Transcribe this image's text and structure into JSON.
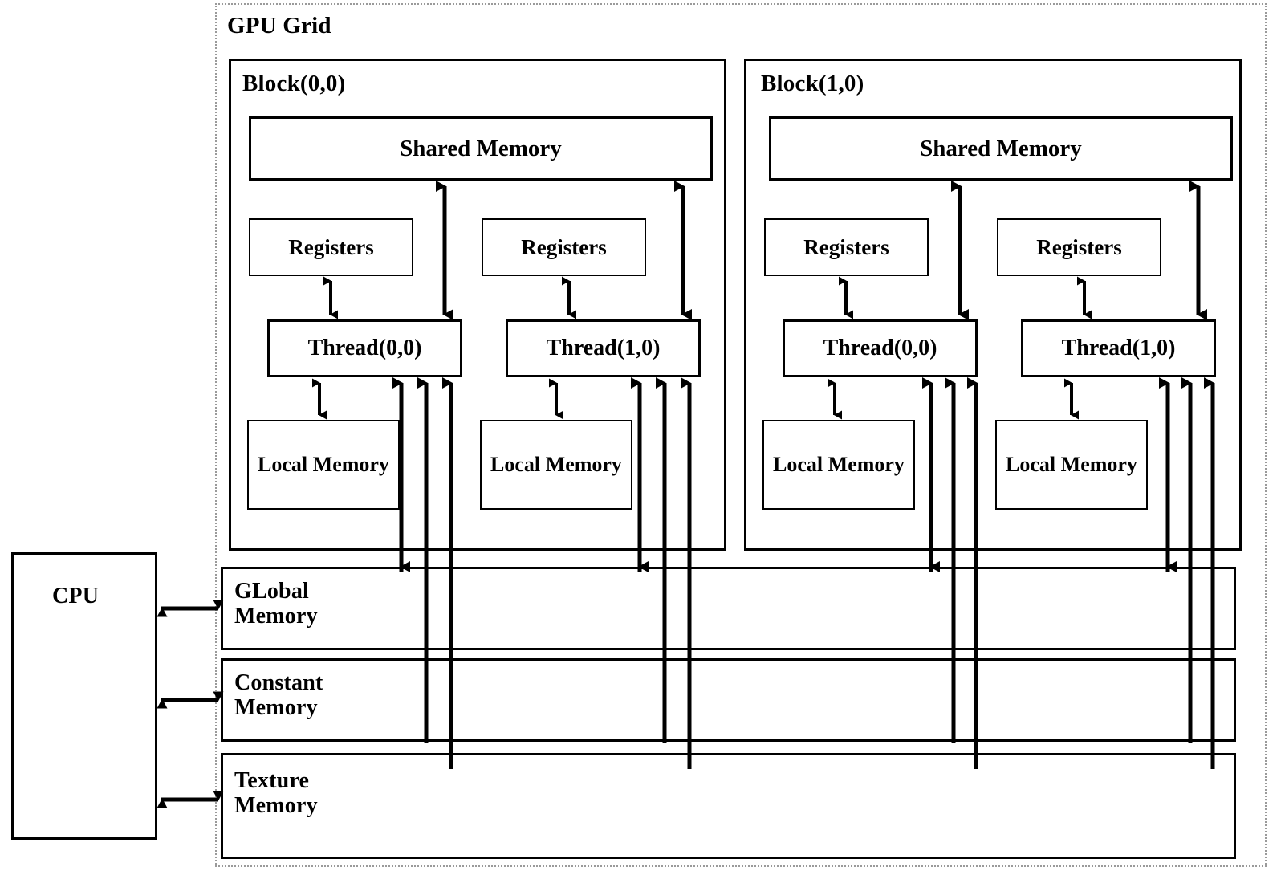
{
  "diagram": {
    "title": "GPU Grid",
    "type": "cuda-memory-hierarchy"
  },
  "host": {
    "cpu_label": "CPU"
  },
  "blocks": [
    {
      "label": "Block(0,0)",
      "shared_memory_label": "Shared  Memory",
      "threads": [
        {
          "registers_label": "Registers",
          "thread_label": "Thread(0,0)",
          "local_memory_label": "Local\nMemory"
        },
        {
          "registers_label": "Registers",
          "thread_label": "Thread(1,0)",
          "local_memory_label": "Local\nMemory"
        }
      ]
    },
    {
      "label": "Block(1,0)",
      "shared_memory_label": "Shared  Memory",
      "threads": [
        {
          "registers_label": "Registers",
          "thread_label": "Thread(0,0)",
          "local_memory_label": "Local\nMemory"
        },
        {
          "registers_label": "Registers",
          "thread_label": "Thread(1,0)",
          "local_memory_label": "Local\nMemory"
        }
      ]
    }
  ],
  "device_memories": [
    {
      "label": "GLobal\nMemory"
    },
    {
      "label": "Constant\nMemory"
    },
    {
      "label": "Texture\nMemory"
    }
  ],
  "colors": {
    "stroke": "#000000",
    "background": "#ffffff",
    "grid_border": "#9a9a9a"
  }
}
